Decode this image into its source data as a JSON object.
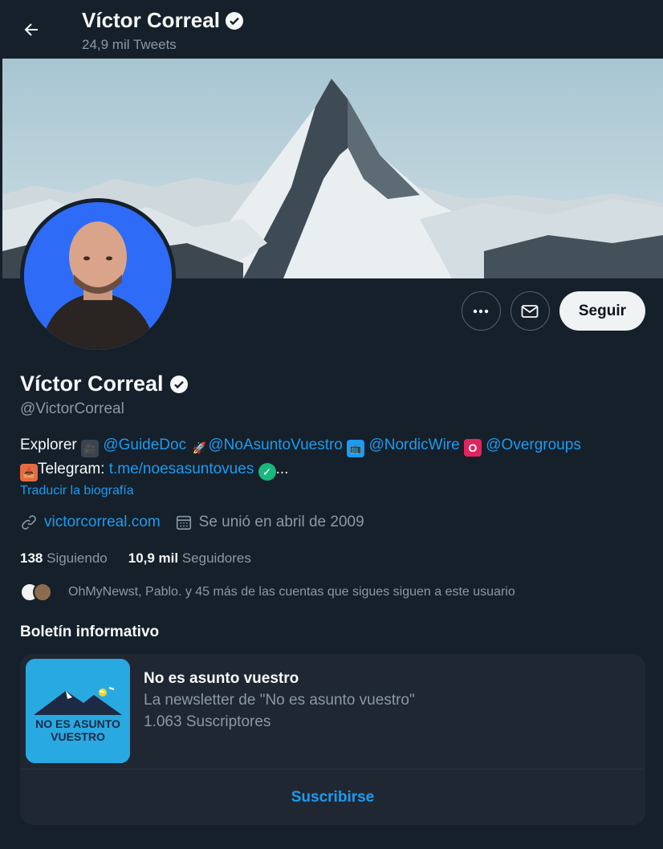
{
  "header": {
    "name": "Víctor Correal",
    "tweets_count": "24,9 mil Tweets"
  },
  "actions": {
    "follow_label": "Seguir"
  },
  "profile": {
    "name": "Víctor Correal",
    "handle": "@VictorCorreal",
    "bio": {
      "prefix": "Explorer",
      "mention1": "@GuideDoc",
      "mention2": "@NoAsuntoVuestro",
      "mention3": "@NordicWire",
      "mention4": "@Overgroups",
      "telegram_label": "Telegram:",
      "telegram_link": "t.me/noesasuntovues",
      "ellipsis": "..."
    },
    "translate": "Traducir la biografía",
    "website": "victorcorreal.com",
    "joined": "Se unió en abril de 2009"
  },
  "stats": {
    "following_count": "138",
    "following_label": "Siguiendo",
    "followers_count": "10,9 mil",
    "followers_label": "Seguidores"
  },
  "followed_by": "OhMyNewst, Pablo. y 45 más de las cuentas que sigues siguen a este usuario",
  "newsletter": {
    "section_title": "Boletín informativo",
    "name": "No es asunto vuestro",
    "description": "La newsletter de \"No es asunto vuestro\"",
    "subscribers": "1.063 Suscriptores",
    "subscribe_label": "Suscribirse",
    "logo_line1": "NO ES ASUNTO",
    "logo_line2": "VUESTRO"
  },
  "colors": {
    "background": "#15202b",
    "accent": "#1d9bf0",
    "secondary_text": "#8b98a5"
  }
}
